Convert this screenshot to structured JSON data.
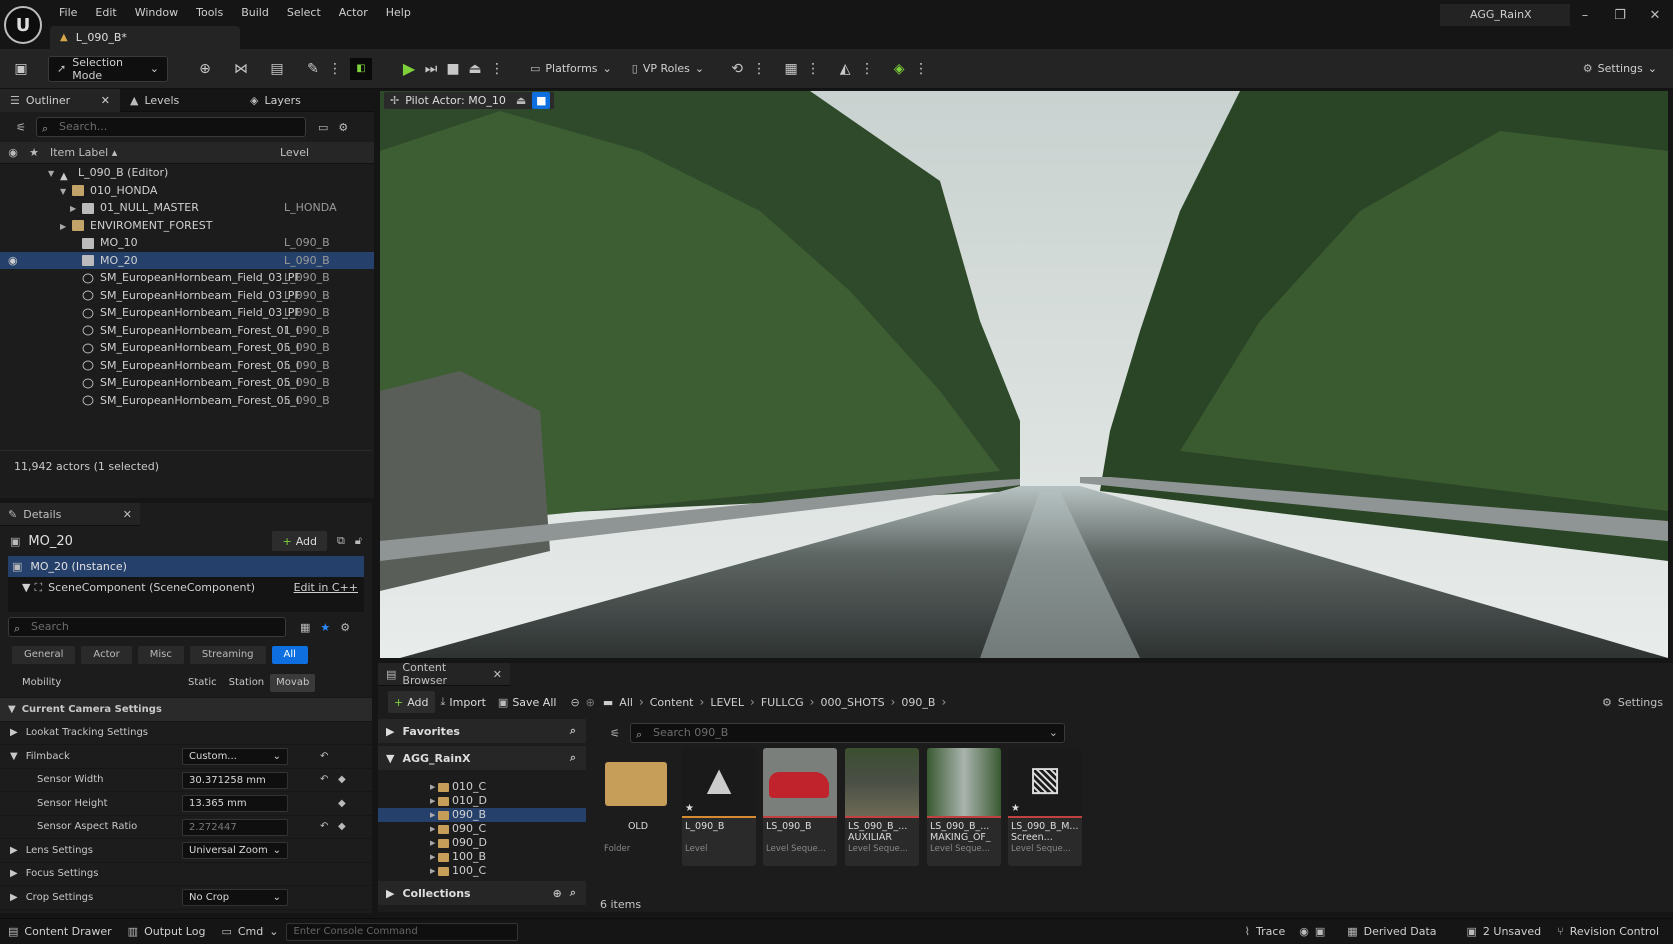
{
  "app": {
    "logo": "U"
  },
  "menu": [
    "File",
    "Edit",
    "Window",
    "Tools",
    "Build",
    "Select",
    "Actor",
    "Help"
  ],
  "doc_tab": "L_090_B*",
  "project": "AGG_RainX",
  "toolbar": {
    "mode": "Selection Mode",
    "platforms": "Platforms",
    "vp_roles": "VP Roles",
    "settings": "Settings"
  },
  "outliner": {
    "tabs": [
      "Outliner",
      "Levels",
      "Layers"
    ],
    "search_placeholder": "Search...",
    "col_label": "Item Label",
    "col_level": "Level",
    "rows": [
      {
        "label": "L_090_B (Editor)",
        "level": "",
        "icon": "level-icon",
        "expander": "▼"
      },
      {
        "label": "010_HONDA",
        "level": "",
        "icon": "folder-icon",
        "expander": "▼"
      },
      {
        "label": "01_NULL_MASTER",
        "level": "L_HONDA",
        "icon": "actor-icon",
        "expander": "▶"
      },
      {
        "label": "ENVIROMENT_FOREST",
        "level": "",
        "icon": "folder-icon",
        "expander": "▶"
      },
      {
        "label": "MO_10",
        "level": "L_090_B",
        "icon": "actor-icon",
        "expander": ""
      },
      {
        "label": "MO_20",
        "level": "L_090_B",
        "icon": "actor-icon",
        "expander": ""
      },
      {
        "label": "SM_EuropeanHornbeam_Field_03_PF",
        "level": "L_090_B",
        "icon": "mesh-icon",
        "expander": ""
      },
      {
        "label": "SM_EuropeanHornbeam_Field_03_PF",
        "level": "L_090_B",
        "icon": "mesh-icon",
        "expander": ""
      },
      {
        "label": "SM_EuropeanHornbeam_Field_03_PF",
        "level": "L_090_B",
        "icon": "mesh-icon",
        "expander": ""
      },
      {
        "label": "SM_EuropeanHornbeam_Forest_01_I",
        "level": "L_090_B",
        "icon": "mesh-icon",
        "expander": ""
      },
      {
        "label": "SM_EuropeanHornbeam_Forest_05_I",
        "level": "L_090_B",
        "icon": "mesh-icon",
        "expander": ""
      },
      {
        "label": "SM_EuropeanHornbeam_Forest_05_I",
        "level": "L_090_B",
        "icon": "mesh-icon",
        "expander": ""
      },
      {
        "label": "SM_EuropeanHornbeam_Forest_05_I",
        "level": "L_090_B",
        "icon": "mesh-icon",
        "expander": ""
      },
      {
        "label": "SM_EuropeanHornbeam_Forest_05_I",
        "level": "L_090_B",
        "icon": "mesh-icon",
        "expander": ""
      }
    ],
    "footer": "11,942 actors (1 selected)"
  },
  "details": {
    "tab": "Details",
    "actor_name": "MO_20",
    "add": "Add",
    "instance": "MO_20 (Instance)",
    "scene_component": "SceneComponent (SceneComponent)",
    "edit_cpp": "Edit in C++",
    "search_placeholder": "Search",
    "filters": [
      "General",
      "Actor",
      "Misc",
      "Streaming",
      "All"
    ],
    "mobility_label": "Mobility",
    "mobility_options": [
      "Static",
      "Station",
      "Movab"
    ],
    "section_camera": "Current Camera Settings",
    "lookat": "Lookat Tracking Settings",
    "filmback": "Filmback",
    "filmback_value": "Custom...",
    "sensor_width": "Sensor Width",
    "sensor_width_value": "30.371258 mm",
    "sensor_height": "Sensor Height",
    "sensor_height_value": "13.365 mm",
    "sensor_aspect": "Sensor Aspect Ratio",
    "sensor_aspect_value": "2.272447",
    "lens": "Lens Settings",
    "lens_value": "Universal Zoom",
    "focus": "Focus Settings",
    "crop": "Crop Settings",
    "crop_value": "No Crop"
  },
  "viewport": {
    "pilot": "Pilot Actor: MO_10"
  },
  "content_browser": {
    "tab": "Content Browser",
    "add": "Add",
    "import": "Import",
    "save_all": "Save All",
    "breadcrumbs": [
      "All",
      "Content",
      "LEVEL",
      "FULLCG",
      "000_SHOTS",
      "090_B"
    ],
    "settings": "Settings",
    "favorites": "Favorites",
    "project_root": "AGG_RainX",
    "tree": [
      "010_C",
      "010_D",
      "090_B",
      "090_C",
      "090_D",
      "100_B",
      "100_C"
    ],
    "selected_tree": "090_B",
    "collections": "Collections",
    "search_placeholder": "Search 090_B",
    "assets": [
      {
        "name": "OLD",
        "type": "Folder"
      },
      {
        "name": "L_090_B",
        "type": "Level"
      },
      {
        "name": "LS_090_B",
        "type": "Level Seque..."
      },
      {
        "name": "LS_090_B_... AUXILIAR",
        "type": "Level Seque..."
      },
      {
        "name": "LS_090_B_... MAKING_OF_",
        "type": "Level Seque..."
      },
      {
        "name": "LS_090_B_M... Screen...",
        "type": "Level Seque..."
      }
    ],
    "count": "6 items"
  },
  "statusbar": {
    "content_drawer": "Content Drawer",
    "output_log": "Output Log",
    "cmd": "Cmd",
    "console_placeholder": "Enter Console Command",
    "trace": "Trace",
    "derived_data": "Derived Data",
    "unsaved": "2 Unsaved",
    "revision": "Revision Control"
  },
  "colors": {
    "accent": "#0e70e0",
    "selection": "#25416b",
    "play": "#7fd13b"
  }
}
